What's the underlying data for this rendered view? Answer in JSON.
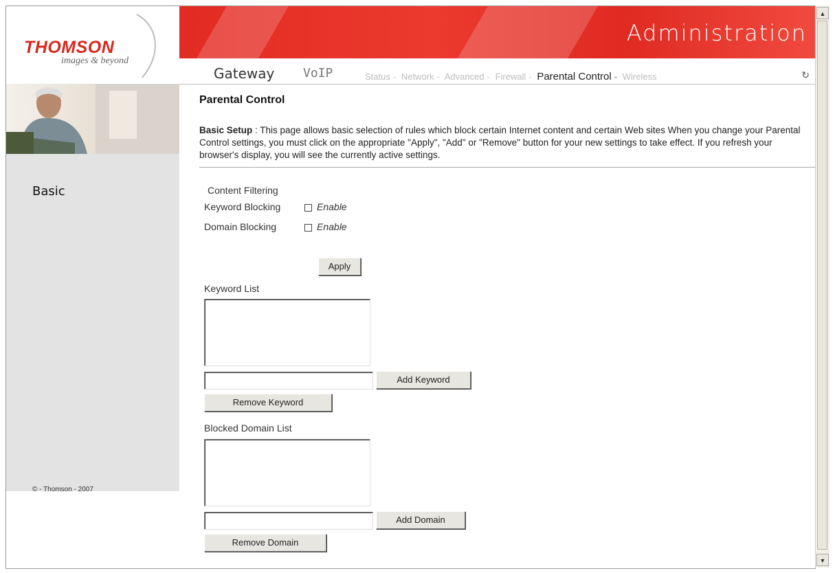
{
  "header": {
    "brand": "THOMSON",
    "tagline": "images & beyond",
    "section_title": "Administration",
    "nav_main": [
      "Gateway",
      "VoIP"
    ],
    "subnav": [
      "Status",
      "Network",
      "Advanced",
      "Firewall",
      "Parental Control",
      "Wireless"
    ],
    "subnav_active": "Parental Control",
    "brand_color": "#d8281e",
    "banner_color": "#e22b22"
  },
  "sidebar": {
    "item": "Basic",
    "copyright": "© - Thomson - 2007"
  },
  "main": {
    "title": "Parental Control",
    "intro_label": "Basic Setup",
    "intro_sep": " : ",
    "intro_text": "This page allows basic selection of rules which block certain Internet content and certain Web sites When you change your Parental Control settings, you must click on the appropriate \"Apply\", \"Add\" or \"Remove\" button for your new settings to take effect. If you refresh your browser's display, you will see the currently active settings.",
    "content_filtering_label": "Content Filtering",
    "keyword_blocking_label": "Keyword Blocking",
    "domain_blocking_label": "Domain Blocking",
    "enable_label": "Enable",
    "keyword_blocking_enabled": false,
    "domain_blocking_enabled": false,
    "apply_label": "Apply",
    "keyword_list_label": "Keyword List",
    "keyword_input_value": "",
    "add_keyword_label": "Add Keyword",
    "remove_keyword_label": "Remove Keyword",
    "blocked_domain_list_label": "Blocked Domain List",
    "domain_input_value": "",
    "add_domain_label": "Add Domain",
    "remove_domain_label": "Remove Domain"
  }
}
